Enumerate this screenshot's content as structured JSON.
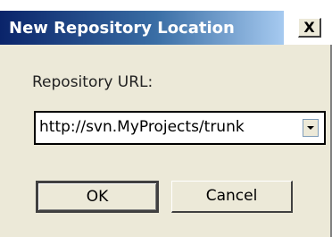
{
  "window": {
    "title": "New Repository Location",
    "close_label": "X"
  },
  "form": {
    "url_label": "Repository URL:",
    "url_value": "http://svn.MyProjects/trunk"
  },
  "buttons": {
    "ok_label": "OK",
    "cancel_label": "Cancel"
  },
  "colors": {
    "titlebar_start": "#0a246a",
    "titlebar_end": "#a6caf0",
    "dialog_background": "#ece9d8"
  }
}
